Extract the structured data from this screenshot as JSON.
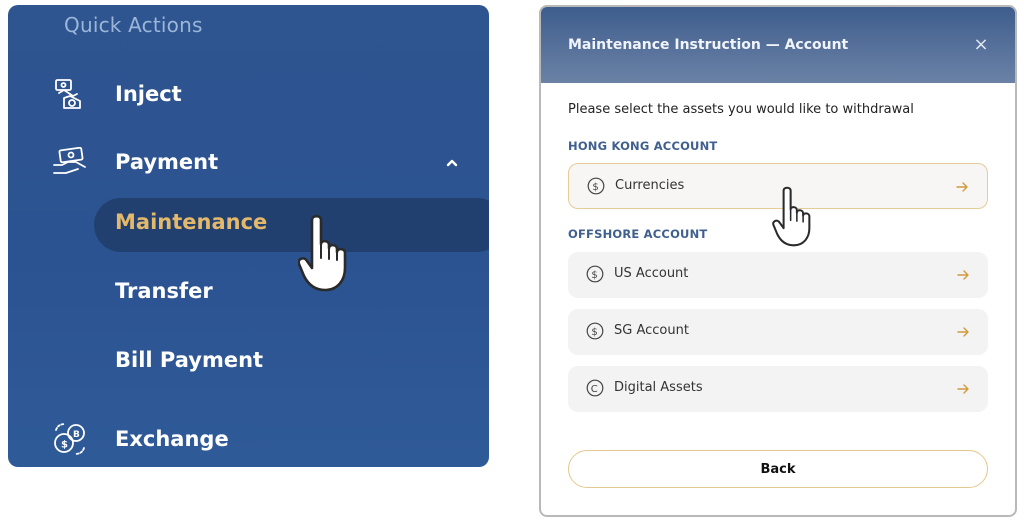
{
  "nav": {
    "section_title": "Quick Actions",
    "items": {
      "inject": "Inject",
      "payment": "Payment",
      "exchange": "Exchange"
    },
    "payment_sub": {
      "maintenance": "Maintenance",
      "transfer": "Transfer",
      "bill_payment": "Bill Payment"
    }
  },
  "dialog": {
    "title": "Maintenance Instruction — Account",
    "close": "×",
    "prompt": "Please select the assets you would like to withdrawal",
    "hk_section": "HONG KONG ACCOUNT",
    "offshore_section": "OFFSHORE ACCOUNT",
    "options": {
      "currencies": "Currencies",
      "us_account": "US Account",
      "sg_account": "SG Account",
      "digital_assets": "Digital Assets"
    },
    "back": "Back"
  },
  "colors": {
    "nav_bg": "#2e5590",
    "accent_gold": "#e3b86a",
    "section_blue": "#3f5f8f"
  },
  "icons": {
    "inject": "hand-money-icon",
    "payment": "cash-payment-icon",
    "exchange": "currency-exchange-icon",
    "caret": "chevron-up-icon",
    "dollar": "dollar-circle-icon",
    "crypto": "coin-circle-icon",
    "arrow": "arrow-right-icon",
    "cursor": "hand-pointer-icon"
  }
}
